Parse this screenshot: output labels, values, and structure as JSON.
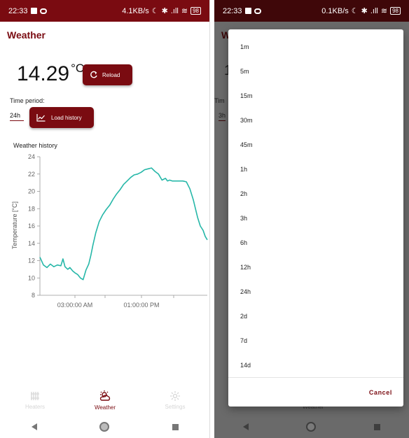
{
  "status_left": {
    "time": "22:33",
    "net_speed": "4.1KB/s",
    "signal": ".ıll",
    "battery": "98"
  },
  "status_right": {
    "time": "22:33",
    "net_speed": "0.1KB/s",
    "signal": ".ıll",
    "battery": "98"
  },
  "app": {
    "title": "Weather"
  },
  "current": {
    "value": "14.29",
    "unit": "°C"
  },
  "buttons": {
    "reload": "Reload",
    "load_history": "Load history"
  },
  "period": {
    "label": "Time period:",
    "selected": "24h"
  },
  "bottom_nav": {
    "heaters": "Heaters",
    "weather": "Weather",
    "settings": "Settings"
  },
  "background_right": {
    "title": "W",
    "temp_partial": "1",
    "period_partial": "Tim",
    "selected": "3h",
    "nav_label": "Weather"
  },
  "dialog": {
    "options": [
      "1m",
      "5m",
      "15m",
      "30m",
      "45m",
      "1h",
      "2h",
      "3h",
      "6h",
      "12h",
      "24h",
      "2d",
      "7d",
      "14d"
    ],
    "cancel": "Cancel"
  },
  "colors": {
    "primary": "#7a0b11",
    "line": "#26b7a8",
    "status_dark": "#3f0709"
  },
  "icons": {
    "reload": "refresh-icon",
    "history": "line-chart-icon",
    "heaters": "radiator-icon",
    "weather": "partly-cloudy-icon",
    "settings": "gear-icon"
  },
  "chart_data": {
    "type": "line",
    "title": "Weather history",
    "xlabel": "",
    "ylabel": "Temperature [°C]",
    "ylim": [
      8,
      24
    ],
    "yticks": [
      8,
      10,
      12,
      14,
      16,
      18,
      20,
      22,
      24
    ],
    "xtick_labels": [
      "03:00:00 AM",
      "01:00:00 PM"
    ],
    "grid": false,
    "series": [
      {
        "x": [
          0,
          0.5,
          1.0,
          1.5,
          2.0,
          2.5,
          3.0,
          3.3,
          3.6,
          4.0,
          4.3,
          4.7,
          5.0,
          5.4,
          5.8,
          6.2,
          6.6,
          7.0,
          7.3,
          7.6,
          8.0,
          8.5,
          9.0,
          9.5,
          10.0,
          10.5,
          11.0,
          11.5,
          12.0,
          12.5,
          13.0,
          13.5,
          14.0,
          14.5,
          15.0,
          15.5,
          16.0,
          16.5,
          17.0,
          17.5,
          18.0,
          18.3,
          18.6,
          19.0,
          19.5,
          20.0,
          20.5,
          21.0,
          21.5,
          22.0,
          22.3,
          22.6,
          23.0,
          23.4,
          23.7,
          24.0
        ],
        "y": [
          12.4,
          11.5,
          11.2,
          11.6,
          11.3,
          11.5,
          11.4,
          12.2,
          11.3,
          11.0,
          11.2,
          10.8,
          10.6,
          10.4,
          10.0,
          9.8,
          10.9,
          11.6,
          12.6,
          13.8,
          15.2,
          16.5,
          17.3,
          17.9,
          18.4,
          19.1,
          19.7,
          20.2,
          20.8,
          21.2,
          21.6,
          21.9,
          22.0,
          22.2,
          22.5,
          22.6,
          22.7,
          22.3,
          22.0,
          21.3,
          21.5,
          21.2,
          21.3,
          21.2,
          21.2,
          21.2,
          21.2,
          21.1,
          20.3,
          19.0,
          18.0,
          17.0,
          16.0,
          15.5,
          14.8,
          14.4
        ]
      }
    ]
  }
}
